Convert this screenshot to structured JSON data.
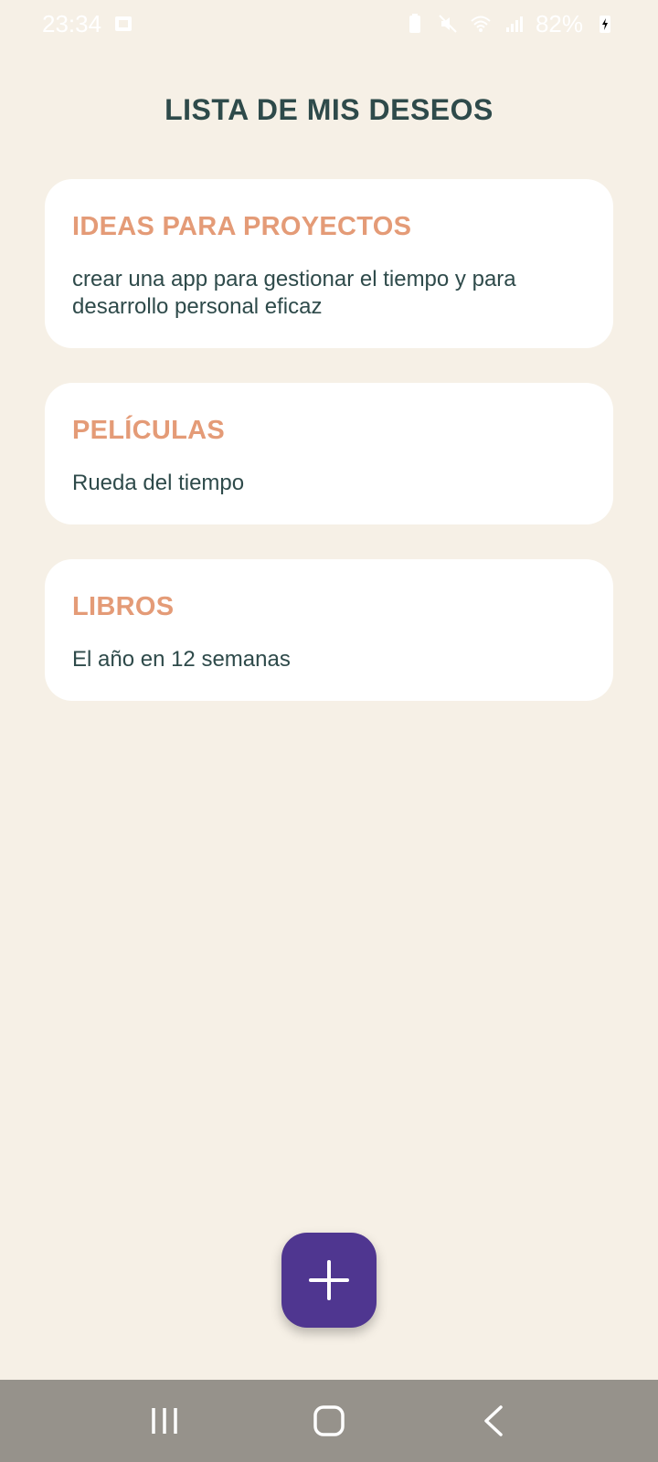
{
  "status_bar": {
    "time": "23:34",
    "battery": "82%"
  },
  "header": {
    "title": "LISTA DE MIS DESEOS"
  },
  "wishlist": {
    "items": [
      {
        "title": "IDEAS PARA PROYECTOS",
        "text": "crear una app para gestionar el tiempo y para desarrollo personal eficaz"
      },
      {
        "title": "PELÍCULAS",
        "text": "Rueda del tiempo"
      },
      {
        "title": "LIBROS",
        "text": "El año en 12 semanas"
      }
    ]
  },
  "colors": {
    "background": "#f6f0e6",
    "title": "#2e4a4a",
    "card_title": "#e49b77",
    "fab": "#4f3690",
    "nav_bar": "#96928b"
  },
  "icons": {
    "fab": "plus-icon",
    "nav": [
      "recent-apps-icon",
      "home-icon",
      "back-icon"
    ]
  }
}
